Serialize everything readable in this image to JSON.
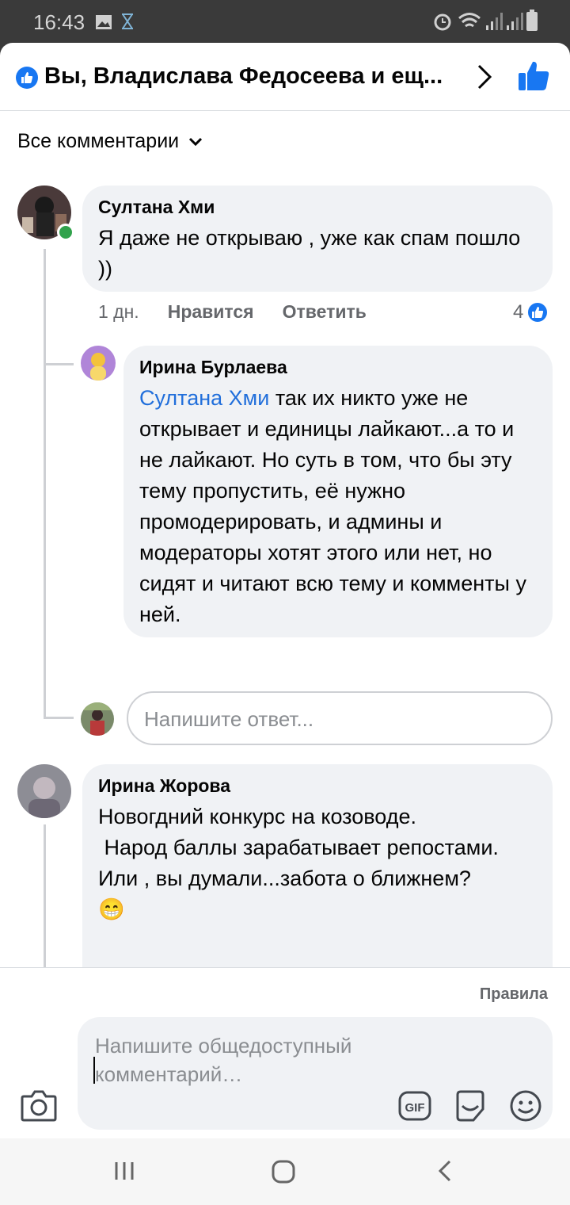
{
  "status_bar": {
    "time": "16:43"
  },
  "header": {
    "title": "Вы, Владислава Федосеева и ещ...",
    "accent": "#1877f2"
  },
  "filter": {
    "label": "Все комментарии"
  },
  "comments": [
    {
      "author": "Султана Хми",
      "text": "Я даже не открываю , уже как спам пошло ))",
      "age": "1 дн.",
      "like_label": "Нравится",
      "reply_label": "Ответить",
      "reactions": "4",
      "replies": [
        {
          "author": "Ирина Бурлаева",
          "mention": "Султана Хми",
          "text": " так их никто уже не открывает и единицы лайкают...а то и не лайкают. Но суть в том, что бы эту тему пропустить, её нужно промодерировать, и админы и модераторы хотят этого или нет, но сидят и читают всю тему и комменты у ней."
        }
      ],
      "reply_placeholder": "Напишите ответ..."
    },
    {
      "author": "Ирина Жорова",
      "text": "Новогдний конкурс на козоводе.\n Народ баллы зарабатывает репостами.\nИли , вы думали...забота о ближнем?\n😁"
    }
  ],
  "composer": {
    "rules_label": "Правила",
    "placeholder": "Напишите общедоступный комментарий…",
    "gif_label": "GIF"
  },
  "icons": [
    "like-badge-icon",
    "chevron-right-icon",
    "thumbs-up-icon",
    "chevron-down-icon",
    "camera-icon",
    "gif-icon",
    "sticker-icon",
    "emoji-icon",
    "recents-icon",
    "home-icon",
    "back-icon"
  ]
}
